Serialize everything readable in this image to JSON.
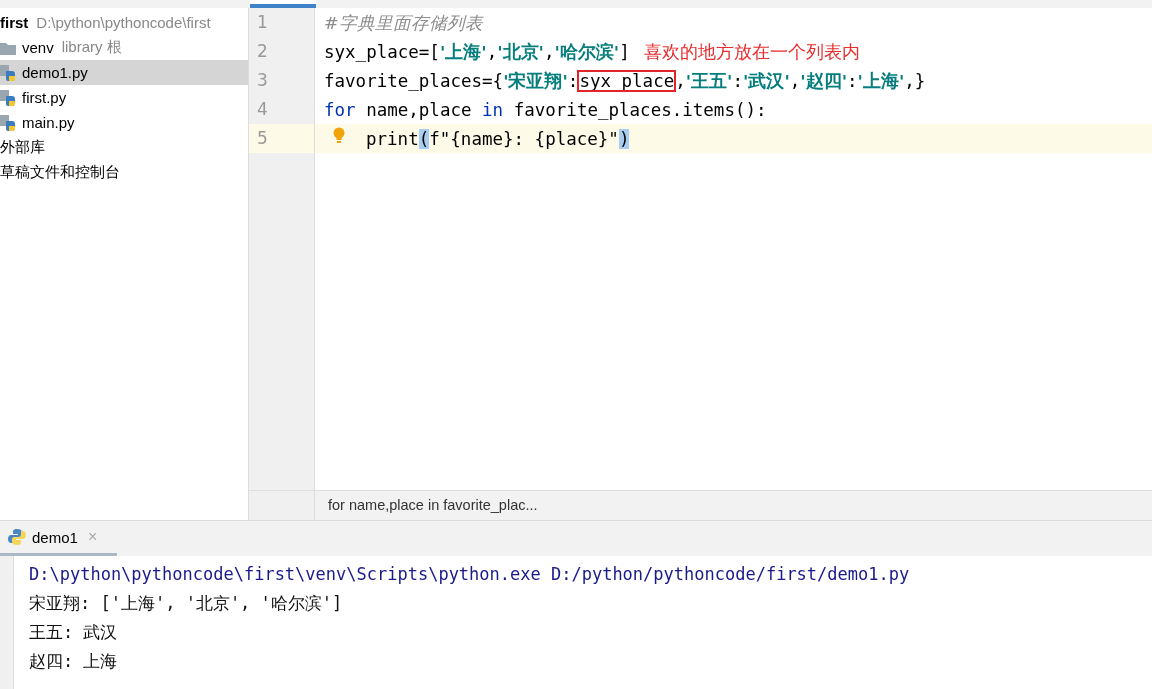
{
  "sidebar": {
    "items": [
      {
        "kind": "project",
        "label": "first",
        "detail": "D:\\python\\pythoncode\\first",
        "selected": false,
        "children": [
          {
            "kind": "folder",
            "label": "venv",
            "detail": "library 根",
            "selected": false
          },
          {
            "kind": "python",
            "label": "demo1.py",
            "selected": true
          },
          {
            "kind": "python",
            "label": "first.py",
            "selected": false
          },
          {
            "kind": "python",
            "label": "main.py",
            "selected": false
          }
        ]
      },
      {
        "kind": "plain",
        "label": "外部库",
        "selected": false
      },
      {
        "kind": "plain",
        "label": "草稿文件和控制台",
        "selected": false
      }
    ]
  },
  "editor": {
    "lines": [
      {
        "number": "1",
        "current": false,
        "indented": false,
        "bulb": false,
        "tokens": [
          {
            "kind": "comment",
            "text": "#字典里面存储列表"
          }
        ]
      },
      {
        "number": "2",
        "current": false,
        "indented": false,
        "bulb": false,
        "tokens": [
          {
            "kind": "plain",
            "text": "syx_place=["
          },
          {
            "kind": "string",
            "text": "'上海'"
          },
          {
            "kind": "plain",
            "text": ","
          },
          {
            "kind": "string",
            "text": "'北京'"
          },
          {
            "kind": "plain",
            "text": ","
          },
          {
            "kind": "string",
            "text": "'哈尔滨'"
          },
          {
            "kind": "plain",
            "text": "]"
          },
          {
            "kind": "note",
            "text": "喜欢的地方放在一个列表内"
          }
        ]
      },
      {
        "number": "3",
        "current": false,
        "indented": false,
        "bulb": false,
        "tokens": [
          {
            "kind": "plain",
            "text": "favorite_places={"
          },
          {
            "kind": "string",
            "text": "'宋亚翔'"
          },
          {
            "kind": "plain",
            "text": ":"
          },
          {
            "kind": "boxed",
            "text": "syx_place"
          },
          {
            "kind": "plain",
            "text": ","
          },
          {
            "kind": "string",
            "text": "'王五'"
          },
          {
            "kind": "plain",
            "text": ":"
          },
          {
            "kind": "string",
            "text": "'武汉'"
          },
          {
            "kind": "plain",
            "text": ","
          },
          {
            "kind": "string",
            "text": "'赵四'"
          },
          {
            "kind": "plain",
            "text": ":"
          },
          {
            "kind": "string",
            "text": "'上海'"
          },
          {
            "kind": "plain",
            "text": ",}"
          }
        ]
      },
      {
        "number": "4",
        "current": false,
        "indented": false,
        "bulb": false,
        "tokens": [
          {
            "kind": "keyword",
            "text": "for"
          },
          {
            "kind": "plain",
            "text": " name,place "
          },
          {
            "kind": "keyword",
            "text": "in"
          },
          {
            "kind": "plain",
            "text": " favorite_places.items():"
          }
        ]
      },
      {
        "number": "5",
        "current": true,
        "indented": true,
        "bulb": true,
        "tokens": [
          {
            "kind": "plain",
            "text": "print"
          },
          {
            "kind": "match",
            "text": "("
          },
          {
            "kind": "plain",
            "text": "f\"{name}: {place}\""
          },
          {
            "kind": "match",
            "text": ")"
          }
        ]
      }
    ],
    "breadcrumb": "for name,place in favorite_plac..."
  },
  "run": {
    "tabs": [
      {
        "label": "demo1",
        "selected": true,
        "close": "×"
      }
    ],
    "console": [
      {
        "kind": "command",
        "text": "D:\\python\\pythoncode\\first\\venv\\Scripts\\python.exe D:/python/pythoncode/first/demo1.py"
      },
      {
        "kind": "output",
        "text": "宋亚翔: ['上海', '北京', '哈尔滨']"
      },
      {
        "kind": "output",
        "text": "王五: 武汉"
      },
      {
        "kind": "output",
        "text": "赵四: 上海"
      }
    ]
  }
}
